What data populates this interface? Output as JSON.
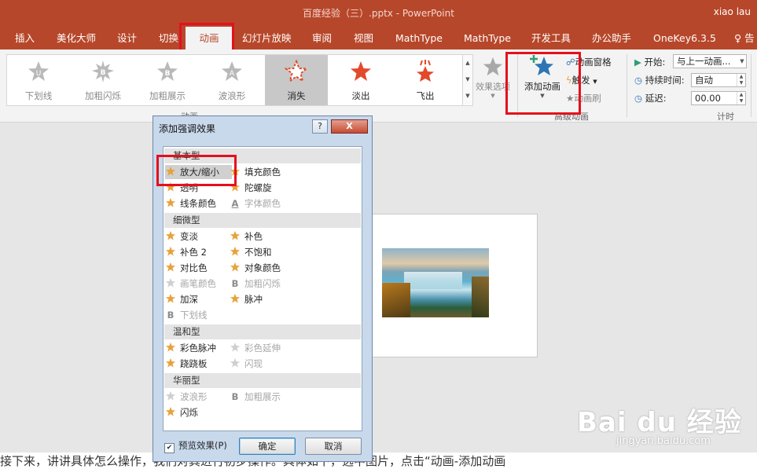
{
  "window": {
    "title": "百度经验（三）.pptx - PowerPoint",
    "user": "xiao lau"
  },
  "tabs": [
    "插入",
    "美化大师",
    "设计",
    "切换",
    "动画",
    "幻灯片放映",
    "审阅",
    "视图",
    "MathType",
    "MathType",
    "开发工具",
    "办公助手",
    "OneKey6.3.5",
    "告"
  ],
  "active_tab": "动画",
  "gallery": {
    "items": [
      {
        "label": "下划线",
        "glyph": "U"
      },
      {
        "label": "加粗闪烁",
        "glyph": "B"
      },
      {
        "label": "加粗展示",
        "glyph": "B"
      },
      {
        "label": "波浪形",
        "glyph": "A"
      },
      {
        "label": "消失",
        "glyph": ""
      },
      {
        "label": "淡出",
        "glyph": ""
      },
      {
        "label": "飞出",
        "glyph": ""
      }
    ],
    "selected": "消失",
    "group_label": "动画"
  },
  "effect_options": {
    "label": "效果选项"
  },
  "advanced": {
    "add_animation": "添加动画",
    "animation_pane": "动画窗格",
    "trigger": "触发",
    "painter": "动画刷",
    "group_label": "高级动画"
  },
  "timing": {
    "start_label": "开始:",
    "start_value": "与上一动画...",
    "duration_label": "持续时间:",
    "duration_value": "自动",
    "delay_label": "延迟:",
    "delay_value": "00.00",
    "group_label": "计时"
  },
  "dialog": {
    "title": "添加强调效果",
    "help": "?",
    "close": "X",
    "categories": [
      {
        "name": "基本型",
        "items": [
          {
            "label": "放大/缩小",
            "icon": "star-gold",
            "enabled": true,
            "selected": true
          },
          {
            "label": "填充颜色",
            "icon": "star-gold",
            "enabled": true
          },
          {
            "label": "透明",
            "icon": "star-gold",
            "enabled": true
          },
          {
            "label": "陀螺旋",
            "icon": "star-gold",
            "enabled": true
          },
          {
            "label": "线条颜色",
            "icon": "star-gold",
            "enabled": true
          },
          {
            "label": "字体颜色",
            "icon": "letter-a",
            "enabled": false
          }
        ]
      },
      {
        "name": "细微型",
        "items": [
          {
            "label": "变淡",
            "icon": "star-gold",
            "enabled": true
          },
          {
            "label": "补色",
            "icon": "star-gold",
            "enabled": true
          },
          {
            "label": "补色 2",
            "icon": "star-gold",
            "enabled": true
          },
          {
            "label": "不饱和",
            "icon": "star-gold",
            "enabled": true
          },
          {
            "label": "对比色",
            "icon": "star-gold",
            "enabled": true
          },
          {
            "label": "对象颜色",
            "icon": "star-gold",
            "enabled": true
          },
          {
            "label": "画笔颜色",
            "icon": "star-gray",
            "enabled": false
          },
          {
            "label": "加粗闪烁",
            "icon": "letter-b",
            "enabled": false
          },
          {
            "label": "加深",
            "icon": "star-gold",
            "enabled": true
          },
          {
            "label": "脉冲",
            "icon": "star-gold",
            "enabled": true
          },
          {
            "label": "下划线",
            "icon": "letter-b",
            "enabled": false
          }
        ]
      },
      {
        "name": "温和型",
        "items": [
          {
            "label": "彩色脉冲",
            "icon": "star-gold",
            "enabled": true
          },
          {
            "label": "彩色延伸",
            "icon": "star-gray",
            "enabled": false
          },
          {
            "label": "跷跷板",
            "icon": "star-gold",
            "enabled": true
          },
          {
            "label": "闪现",
            "icon": "star-gray",
            "enabled": false
          }
        ]
      },
      {
        "name": "华丽型",
        "items": [
          {
            "label": "波浪形",
            "icon": "star-gray",
            "enabled": false
          },
          {
            "label": "加粗展示",
            "icon": "letter-b",
            "enabled": false
          },
          {
            "label": "闪烁",
            "icon": "star-gold",
            "enabled": true
          }
        ]
      }
    ],
    "preview_label": "预览效果(P)",
    "preview_checked": true,
    "ok": "确定",
    "cancel": "取消"
  },
  "article_text": "接下来，讲讲具体怎么操作，我们对其进行初步操作。具体如下，选中图片，点击“动画-添加动画",
  "watermark": {
    "brand": "Bai du 经验",
    "url": "jingyan.baidu.com"
  },
  "colors": {
    "brand": "#b7472a",
    "highlight": "#e5101d",
    "star_gold": "#e6a23c"
  }
}
